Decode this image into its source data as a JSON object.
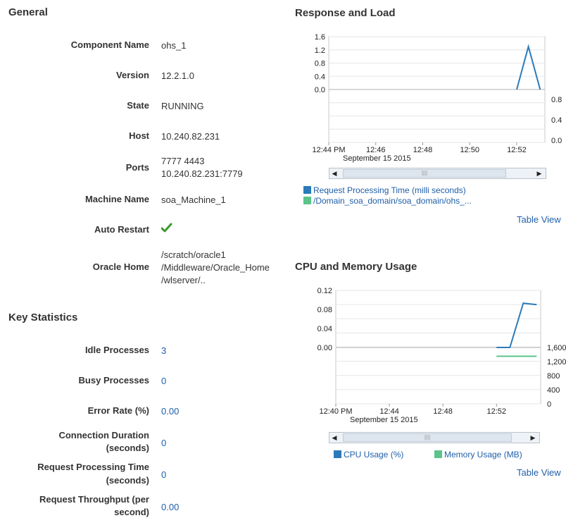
{
  "general": {
    "title": "General",
    "properties": [
      {
        "label": "Component Name",
        "value": "ohs_1"
      },
      {
        "label": "Version",
        "value": "12.2.1.0"
      },
      {
        "label": "State",
        "value": "RUNNING"
      },
      {
        "label": "Host",
        "value": "10.240.82.231"
      },
      {
        "label": "Ports",
        "value_line1": "7777 4443",
        "value_line2": "10.240.82.231:7779"
      },
      {
        "label": "Machine Name",
        "value": "soa_Machine_1"
      },
      {
        "label": "Auto Restart",
        "value_icon": "checkmark-icon"
      },
      {
        "label": "Oracle Home",
        "value_line1": "/scratch/oracle1",
        "value_line2": "/Middleware/Oracle_Home",
        "value_line3": "/wlserver/.."
      }
    ]
  },
  "key_statistics": {
    "title": "Key Statistics",
    "items": [
      {
        "label": "Idle Processes",
        "value": "3"
      },
      {
        "label": "Busy Processes",
        "value": "0"
      },
      {
        "label": "Error Rate (%)",
        "value": "0.00"
      },
      {
        "label_line1": "Connection Duration",
        "label_line2": "(seconds)",
        "value": "0"
      },
      {
        "label_line1": "Request Processing Time",
        "label_line2": "(seconds)",
        "value": "0"
      },
      {
        "label_line1": "Request Throughput (per",
        "label_line2": "second)",
        "value": "0.00"
      }
    ]
  },
  "response_load": {
    "title": "Response and Load",
    "table_view": "Table View",
    "legend": [
      {
        "label": "Request Processing Time (milli seconds)",
        "color": "#2b7bba"
      },
      {
        "label": "/Domain_soa_domain/soa_domain/ohs_...",
        "color": "#5cc48a"
      }
    ]
  },
  "cpu_memory": {
    "title": "CPU and Memory Usage",
    "table_view": "Table View",
    "legend": [
      {
        "label": "CPU Usage (%)",
        "color": "#2b7bba"
      },
      {
        "label": "Memory Usage (MB)",
        "color": "#5cc48a"
      }
    ]
  },
  "chart_data": [
    {
      "type": "line",
      "title": "Response and Load",
      "x_tick_labels": [
        "12:44 PM",
        "12:46",
        "12:48",
        "12:50",
        "12:52"
      ],
      "x_sublabel": "September 15 2015",
      "y_left_ticks": [
        "1.6",
        "1.2",
        "0.8",
        "0.4",
        "0.0"
      ],
      "y_right_ticks": [
        "0.8",
        "0.4",
        "0.0"
      ],
      "ylim_left": [
        0,
        1.6
      ],
      "grid": true,
      "series": [
        {
          "name": "Request Processing Time (milli seconds)",
          "color": "#2b7bba",
          "x": [
            "12:52",
            "12:52:30",
            "12:53"
          ],
          "values": [
            0.0,
            1.3,
            0.0
          ]
        },
        {
          "name": "/Domain_soa_domain/soa_domain/ohs_...",
          "color": "#5cc48a",
          "x": [],
          "values": []
        }
      ]
    },
    {
      "type": "line",
      "title": "CPU and Memory Usage",
      "x_tick_labels": [
        "12:40 PM",
        "12:44",
        "12:48",
        "12:52"
      ],
      "x_sublabel": "September 15 2015",
      "y_left_ticks": [
        "0.12",
        "0.08",
        "0.04",
        "0.00"
      ],
      "y_right_ticks": [
        "1,600",
        "1,200",
        "800",
        "400",
        "0"
      ],
      "ylim_left": [
        0,
        0.12
      ],
      "ylim_right": [
        0,
        1600
      ],
      "grid": true,
      "series": [
        {
          "name": "CPU Usage (%)",
          "color": "#2b7bba",
          "x": [
            "12:52",
            "12:53",
            "12:54",
            "12:55"
          ],
          "values": [
            0.0,
            0.0,
            0.093,
            0.09
          ]
        },
        {
          "name": "Memory Usage (MB)",
          "color": "#5cc48a",
          "x": [
            "12:52",
            "12:55"
          ],
          "values": [
            1350,
            1350
          ]
        }
      ]
    }
  ]
}
